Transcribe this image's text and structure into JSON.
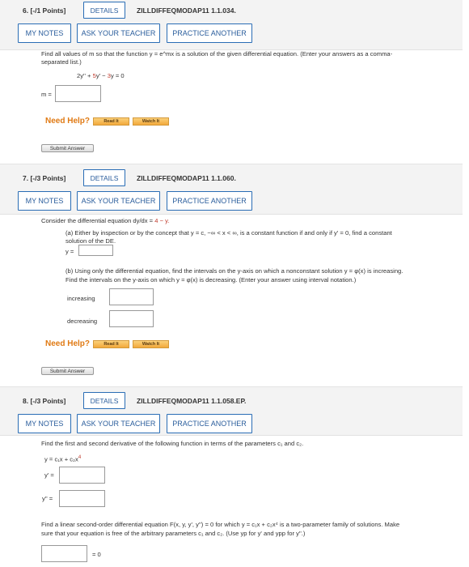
{
  "q6": {
    "points": "6. [-/1 Points]",
    "details": "DETAILS",
    "code": "ZILLDIFFEQMODAP11 1.1.034.",
    "my_notes": "MY NOTES",
    "ask_teacher": "ASK YOUR TEACHER",
    "practice": "PRACTICE ANOTHER",
    "prompt_l1": "Find all values of m so that the function y = e^mx is a solution of the given differential equation. (Enter your answers as a comma-",
    "prompt_l2": "separated list.)",
    "eq_a": "2y'' + ",
    "eq_b": "5",
    "eq_c": "y' − ",
    "eq_d": "3",
    "eq_e": "y = 0",
    "m_label": "m =",
    "need_help": "Need Help?",
    "read_it": "Read It",
    "watch_it": "Watch It",
    "submit": "Submit Answer"
  },
  "q7": {
    "points": "7. [-/3 Points]",
    "details": "DETAILS",
    "code": "ZILLDIFFEQMODAP11 1.1.060.",
    "my_notes": "MY NOTES",
    "ask_teacher": "ASK YOUR TEACHER",
    "practice": "PRACTICE ANOTHER",
    "intro_a": "Consider the differential equation dy/dx = ",
    "intro_b": "4 − y.",
    "part_a_l1": "(a) Either by inspection or by the concept that y = c, −∞ < x < ∞, is a constant function if and only if y' = 0, find a constant",
    "part_a_l2": "solution of the DE.",
    "y_label": "y =",
    "part_b_l1": "(b) Using only the differential equation, find the intervals on the y-axis on which a nonconstant solution y = φ(x) is increasing.",
    "part_b_l2": "Find the intervals on the y-axis on which y = φ(x) is decreasing. (Enter your answer using interval notation.)",
    "increasing": "increasing",
    "decreasing": "decreasing",
    "need_help": "Need Help?",
    "read_it": "Read It",
    "watch_it": "Watch It",
    "submit": "Submit Answer"
  },
  "q8": {
    "points": "8. [-/3 Points]",
    "details": "DETAILS",
    "code": "ZILLDIFFEQMODAP11 1.1.058.EP.",
    "my_notes": "MY NOTES",
    "ask_teacher": "ASK YOUR TEACHER",
    "practice": "PRACTICE ANOTHER",
    "prompt": "Find the first and second derivative of the following function in terms of the parameters c₁ and c₂.",
    "func_a": "y = c₁x + c₂x",
    "func_exp": "4",
    "yp_label": "y' =",
    "ypp_label": "y'' =",
    "linear_l1": "Find a linear second-order differential equation F(x, y, y', y'') = 0 for which y = c₁x + c₂x⁴ is a two-parameter family of solutions. Make",
    "linear_l2": "sure that your equation is free of the arbitrary parameters c₁ and c₂. (Use yp for y' and ypp for y''.)",
    "eq_zero": "= 0"
  }
}
